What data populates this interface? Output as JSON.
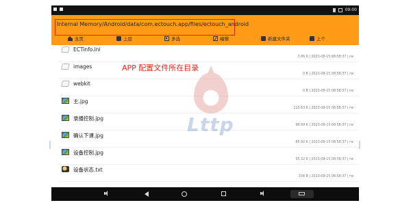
{
  "status_bar": {
    "time": "09:00"
  },
  "header": {
    "path": "Internal Memory/Android/data/com.ectouch.app/files/ectouch_android",
    "toolbar": [
      {
        "label": "主页",
        "icon": "home-icon"
      },
      {
        "label": "上层",
        "icon": "folder-icon"
      },
      {
        "label": "多选",
        "icon": "multi-select-icon"
      },
      {
        "label": "编辑",
        "icon": "edit-icon"
      },
      {
        "label": "新建文件夹",
        "icon": "new-folder-icon"
      },
      {
        "label": "上个",
        "icon": "previous-icon"
      }
    ],
    "accent_color": "#ff9b16"
  },
  "annotation": {
    "text": "APP 配置文件所在目录",
    "color": "#e3271c"
  },
  "watermark": {
    "text": "Lttp"
  },
  "files": [
    {
      "name": "ECTinfo.ini",
      "meta": "3.86 K | 2023-08-15 08:58:37 | rw",
      "icon": "ini-file-icon"
    },
    {
      "name": "images",
      "meta": "0 B | 2023-08-15 08:58:37 | rw",
      "icon": "folder-icon"
    },
    {
      "name": "webkit",
      "meta": "0 B | 2023-08-15 08:58:37 | rw",
      "icon": "folder-icon"
    },
    {
      "name": "主.jpg",
      "meta": "115.63 K | 2023-08-15 08:58:37 | rw",
      "icon": "image-file-icon"
    },
    {
      "name": "录播控制.jpg",
      "meta": "98.99 K | 2023-08-15 08:58:37 | rw",
      "icon": "image-file-icon"
    },
    {
      "name": "确认下课.jpg",
      "meta": "85.92 K | 2023-08-15 08:58:37 | rw",
      "icon": "image-file-icon"
    },
    {
      "name": "设备控制.jpg",
      "meta": "95.32 K | 2023-08-15 08:58:37 | rw",
      "icon": "image-file-icon"
    },
    {
      "name": "设备状态.txt",
      "meta": "108 B | 2023-08-15 08:58:37 | rw",
      "icon": "text-file-icon"
    }
  ]
}
